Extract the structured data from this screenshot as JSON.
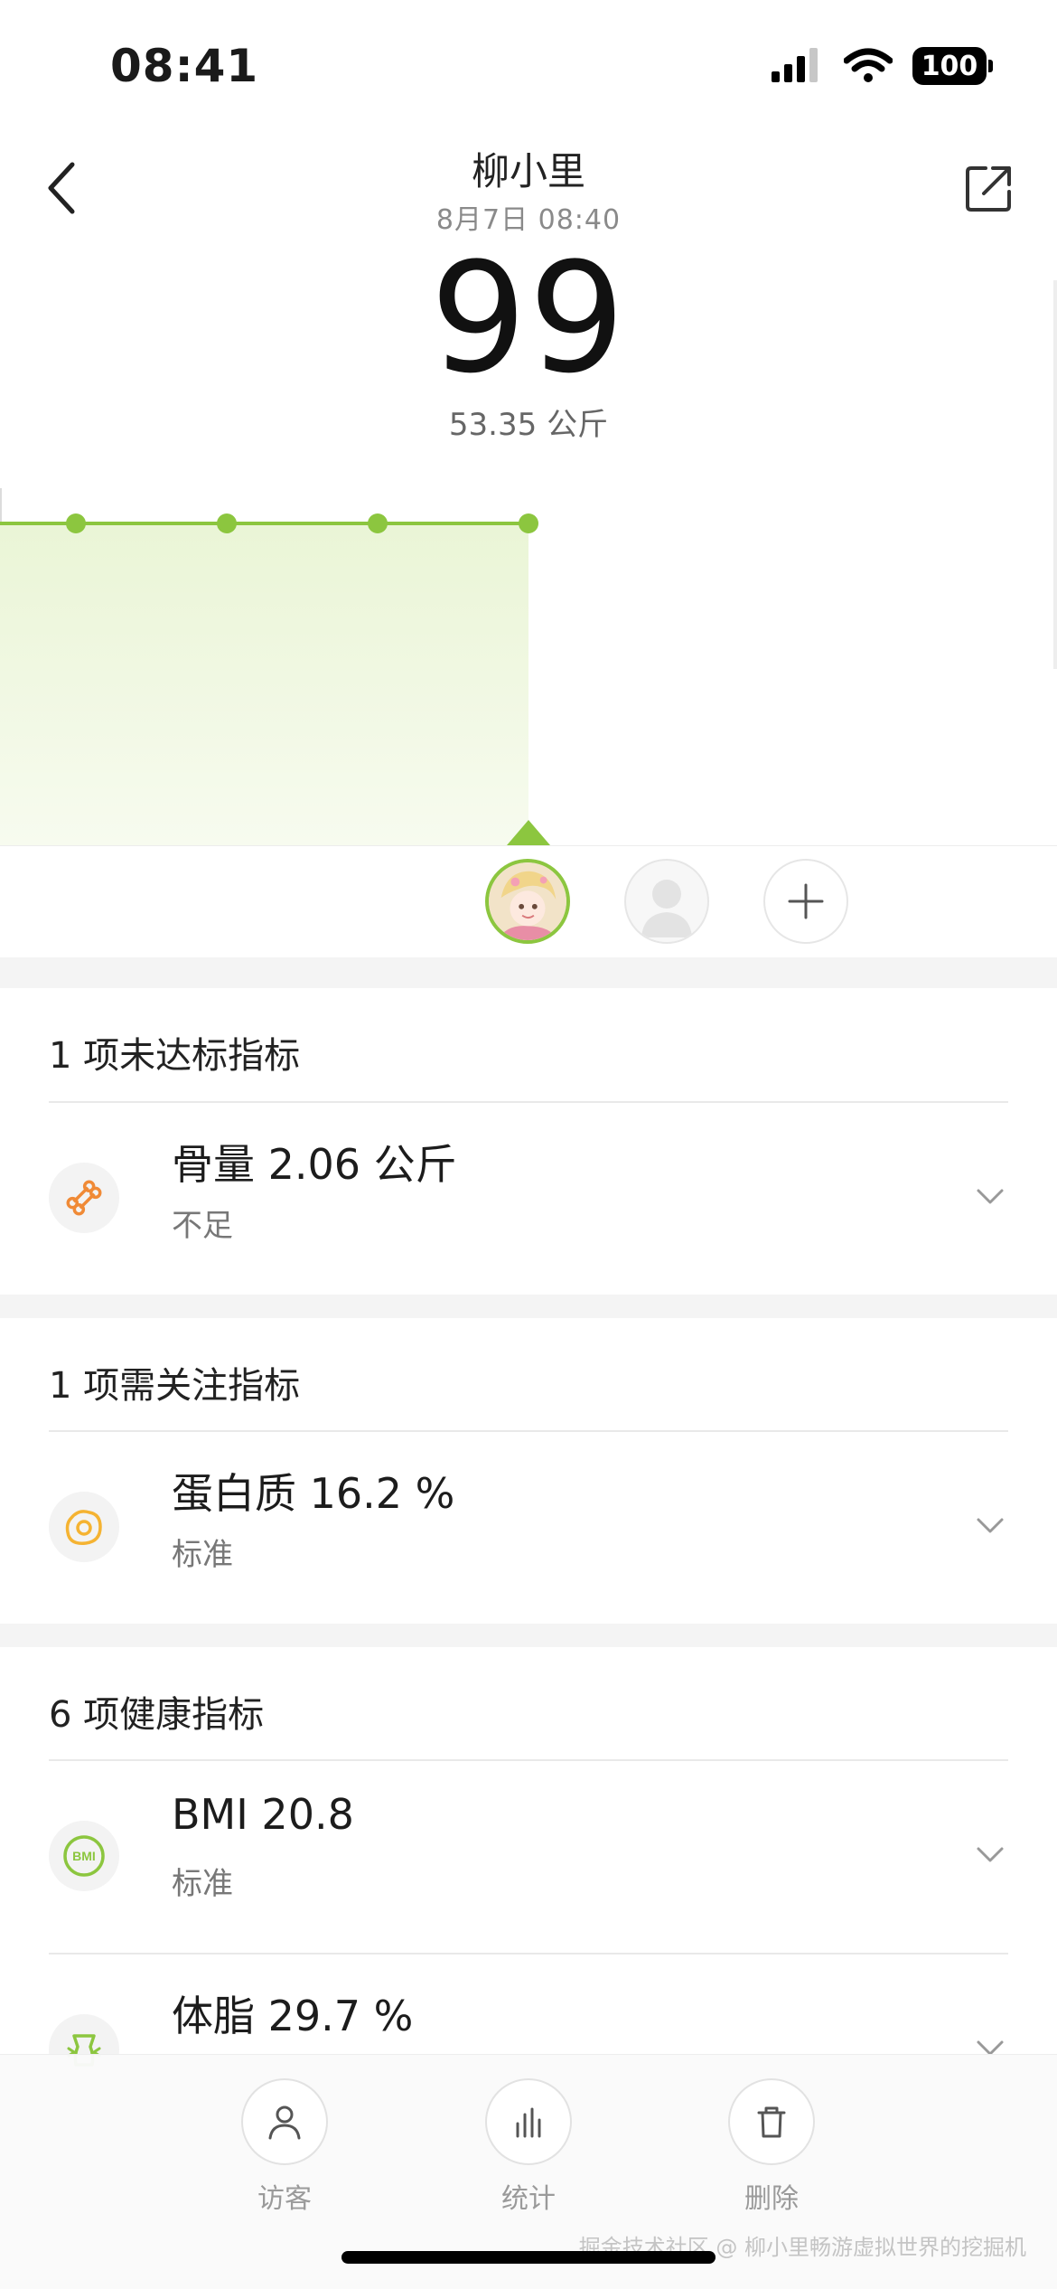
{
  "status_bar": {
    "time": "08:41",
    "battery": "100"
  },
  "header": {
    "title": "柳小里",
    "subtitle": "8月7日 08:40"
  },
  "summary": {
    "score": "99",
    "weight": "53.35 公斤"
  },
  "chart_data": {
    "type": "line",
    "x": [
      1,
      2,
      3,
      4
    ],
    "values": [
      99,
      99,
      99,
      99
    ],
    "title": "",
    "xlabel": "",
    "ylabel": "",
    "selected_index": 3,
    "line_color": "#8cc63f"
  },
  "sections": [
    {
      "title": "1 项未达标指标",
      "items": [
        {
          "name": "骨量 2.06 公斤",
          "status": "不足",
          "icon": "bone-icon",
          "icon_color": "#f08a36"
        }
      ]
    },
    {
      "title": "1 项需关注指标",
      "items": [
        {
          "name": "蛋白质 16.2 %",
          "status": "标准",
          "icon": "egg-icon",
          "icon_color": "#f5b332"
        }
      ]
    },
    {
      "title": "6 项健康指标",
      "items": [
        {
          "name": "BMI 20.8",
          "status": "标准",
          "icon": "bmi-icon",
          "icon_color": "#8cc63f",
          "icon_text": "BMI"
        },
        {
          "name": "体脂 29.7 %",
          "status": "",
          "icon": "body-fat-icon",
          "icon_color": "#8cc63f"
        }
      ]
    }
  ],
  "tabbar": {
    "visitor_label": "访客",
    "stats_label": "统计",
    "delete_label": "删除"
  },
  "watermark": "掘金技术社区 @ 柳小里畅游虚拟世界的挖掘机"
}
